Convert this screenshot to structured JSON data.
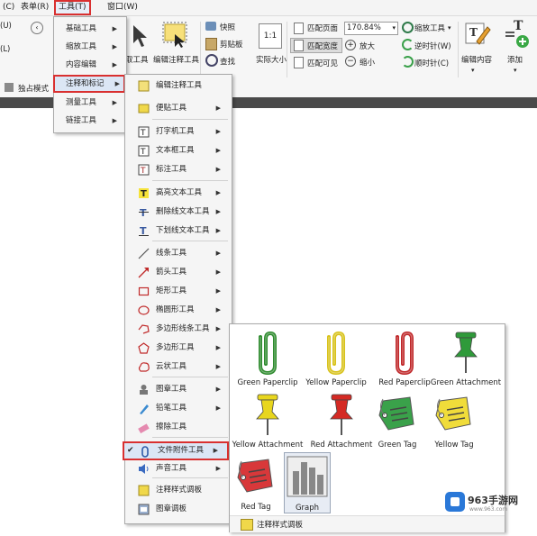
{
  "menubar": {
    "items": [
      "(C)",
      "表单(R)",
      "工具(T)",
      "窗口(W)"
    ]
  },
  "ribbon": {
    "left_items": [
      "(U)",
      "(L)"
    ],
    "hand_tool": "取工具",
    "edit_annot_tool": "编辑注释工具",
    "snapshot": "快照",
    "clipboard": "剪贴板",
    "find": "查找",
    "actual_size": "实际大小",
    "fit_page": "匹配页面",
    "fit_width": "匹配宽度",
    "fit_visible": "匹配可见",
    "zoom_value": "170.84%",
    "zoom_in": "放大",
    "zoom_out": "缩小",
    "zoom_tool": "缩放工具",
    "rotate_ccw": "逆时针(W)",
    "rotate_cw": "顺时针(C)",
    "edit_content": "编辑内容",
    "add": "添加",
    "exclusive_mode": "独占模式"
  },
  "tools_menu": {
    "items": [
      "基础工具",
      "缩放工具",
      "内容编辑",
      "注释和标记",
      "测量工具",
      "链接工具"
    ],
    "highlighted_index": 3
  },
  "annot_menu": {
    "items": [
      "编辑注释工具",
      "便贴工具",
      "打字机工具",
      "文本框工具",
      "标注工具",
      "高亮文本工具",
      "删除线文本工具",
      "下划线文本工具",
      "线条工具",
      "箭头工具",
      "矩形工具",
      "椭圆形工具",
      "多边形线条工具",
      "多边形工具",
      "云状工具",
      "图章工具",
      "铅笔工具",
      "擦除工具",
      "文件附件工具",
      "声音工具",
      "注释样式调板",
      "图章调板"
    ],
    "checked": "文件附件工具"
  },
  "attach_panel": {
    "items": [
      {
        "label": "Green Paperclip",
        "color": "#2e8b2e",
        "kind": "clip"
      },
      {
        "label": "Yellow Paperclip",
        "color": "#d8c21a",
        "kind": "clip"
      },
      {
        "label": "Red Paperclip",
        "color": "#c0282a",
        "kind": "clip"
      },
      {
        "label": "Green Attachment",
        "color": "#2f9a3a",
        "kind": "pin"
      },
      {
        "label": "Yellow Attachment",
        "color": "#e8d61e",
        "kind": "pin"
      },
      {
        "label": "Red Attachment",
        "color": "#d42a24",
        "kind": "pin"
      },
      {
        "label": "Green Tag",
        "color": "#3aa14a",
        "kind": "tag"
      },
      {
        "label": "Yellow Tag",
        "color": "#f0dc3a",
        "kind": "tag"
      },
      {
        "label": "Red Tag",
        "color": "#d8383a",
        "kind": "tag"
      },
      {
        "label": "Graph",
        "color": "#8a8a8a",
        "kind": "graph"
      }
    ],
    "footer": "注释样式调板"
  },
  "watermark": {
    "brand": "963手游网",
    "url": "www.963.com"
  }
}
